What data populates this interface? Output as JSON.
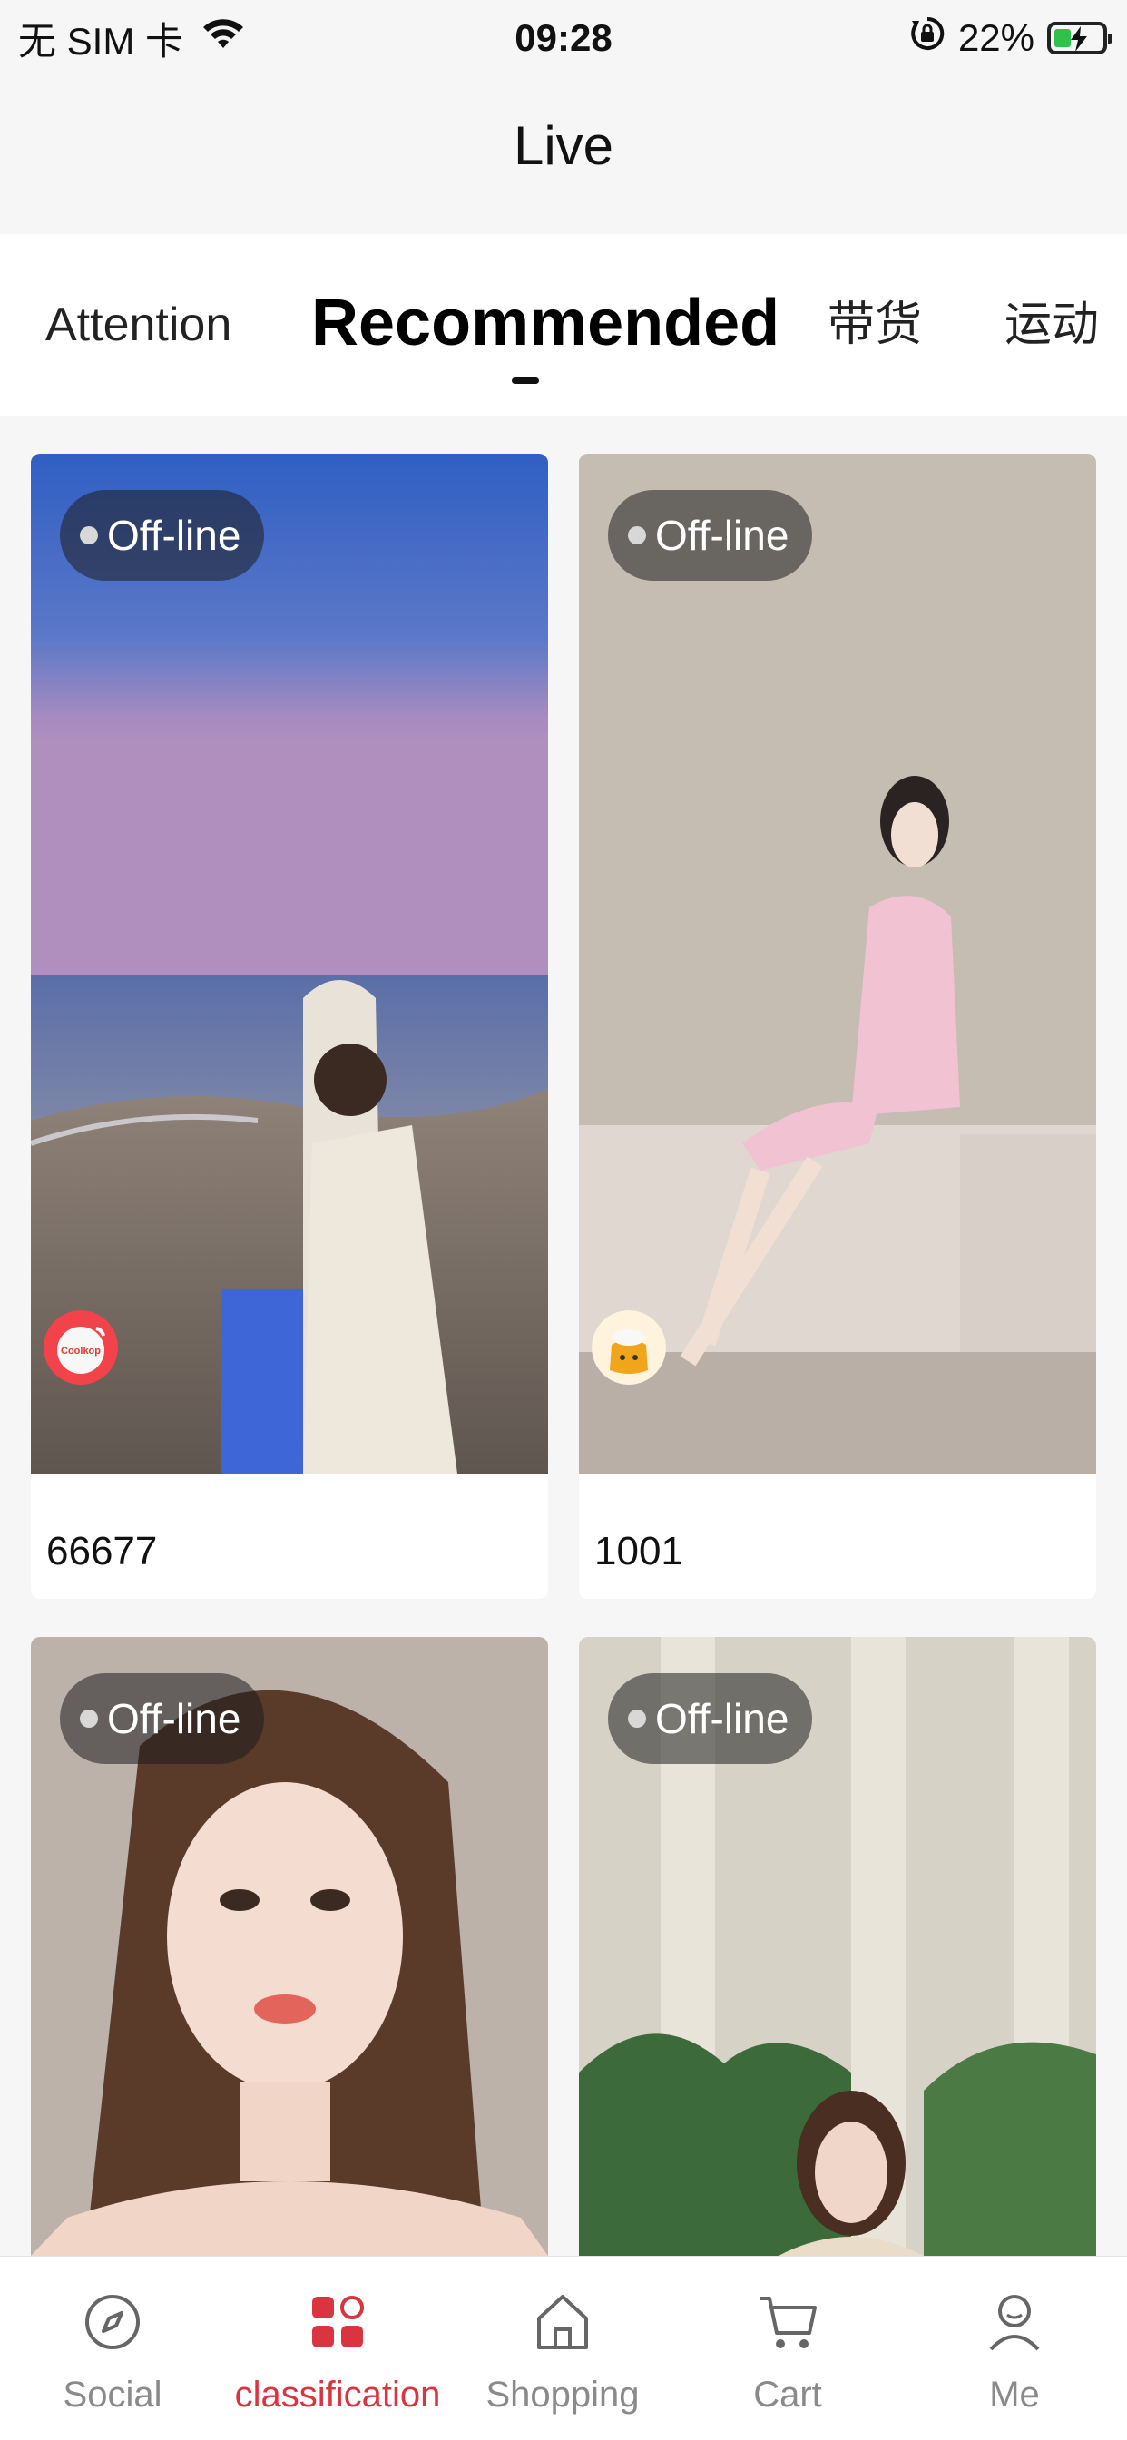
{
  "status_bar": {
    "carrier": "无 SIM 卡",
    "time": "09:28",
    "battery": "22%",
    "battery_level_fraction": 0.22
  },
  "nav": {
    "title": "Live"
  },
  "tabs": [
    {
      "label": "Attention",
      "active": false
    },
    {
      "label": "Recommended",
      "active": true
    },
    {
      "label": "带货",
      "active": false
    },
    {
      "label": "运动",
      "active": false
    }
  ],
  "cards": [
    {
      "status": "Off-line",
      "name": "66677",
      "avatar_text": "Coolkop"
    },
    {
      "status": "Off-line",
      "name": "1001",
      "avatar_icon": "rice-bag-icon"
    },
    {
      "status": "Off-line",
      "name": ""
    },
    {
      "status": "Off-line",
      "name": ""
    }
  ],
  "bottom_nav": [
    {
      "label": "Social",
      "icon": "compass-icon",
      "active": false
    },
    {
      "label": "classification",
      "icon": "grid-icon",
      "active": true
    },
    {
      "label": "Shopping",
      "icon": "home-icon",
      "active": false
    },
    {
      "label": "Cart",
      "icon": "cart-icon",
      "active": false
    },
    {
      "label": "Me",
      "icon": "user-icon",
      "active": false
    }
  ],
  "colors": {
    "accent": "#d9343f",
    "inactive": "#8a8a8a",
    "background": "#f6f6f6"
  }
}
